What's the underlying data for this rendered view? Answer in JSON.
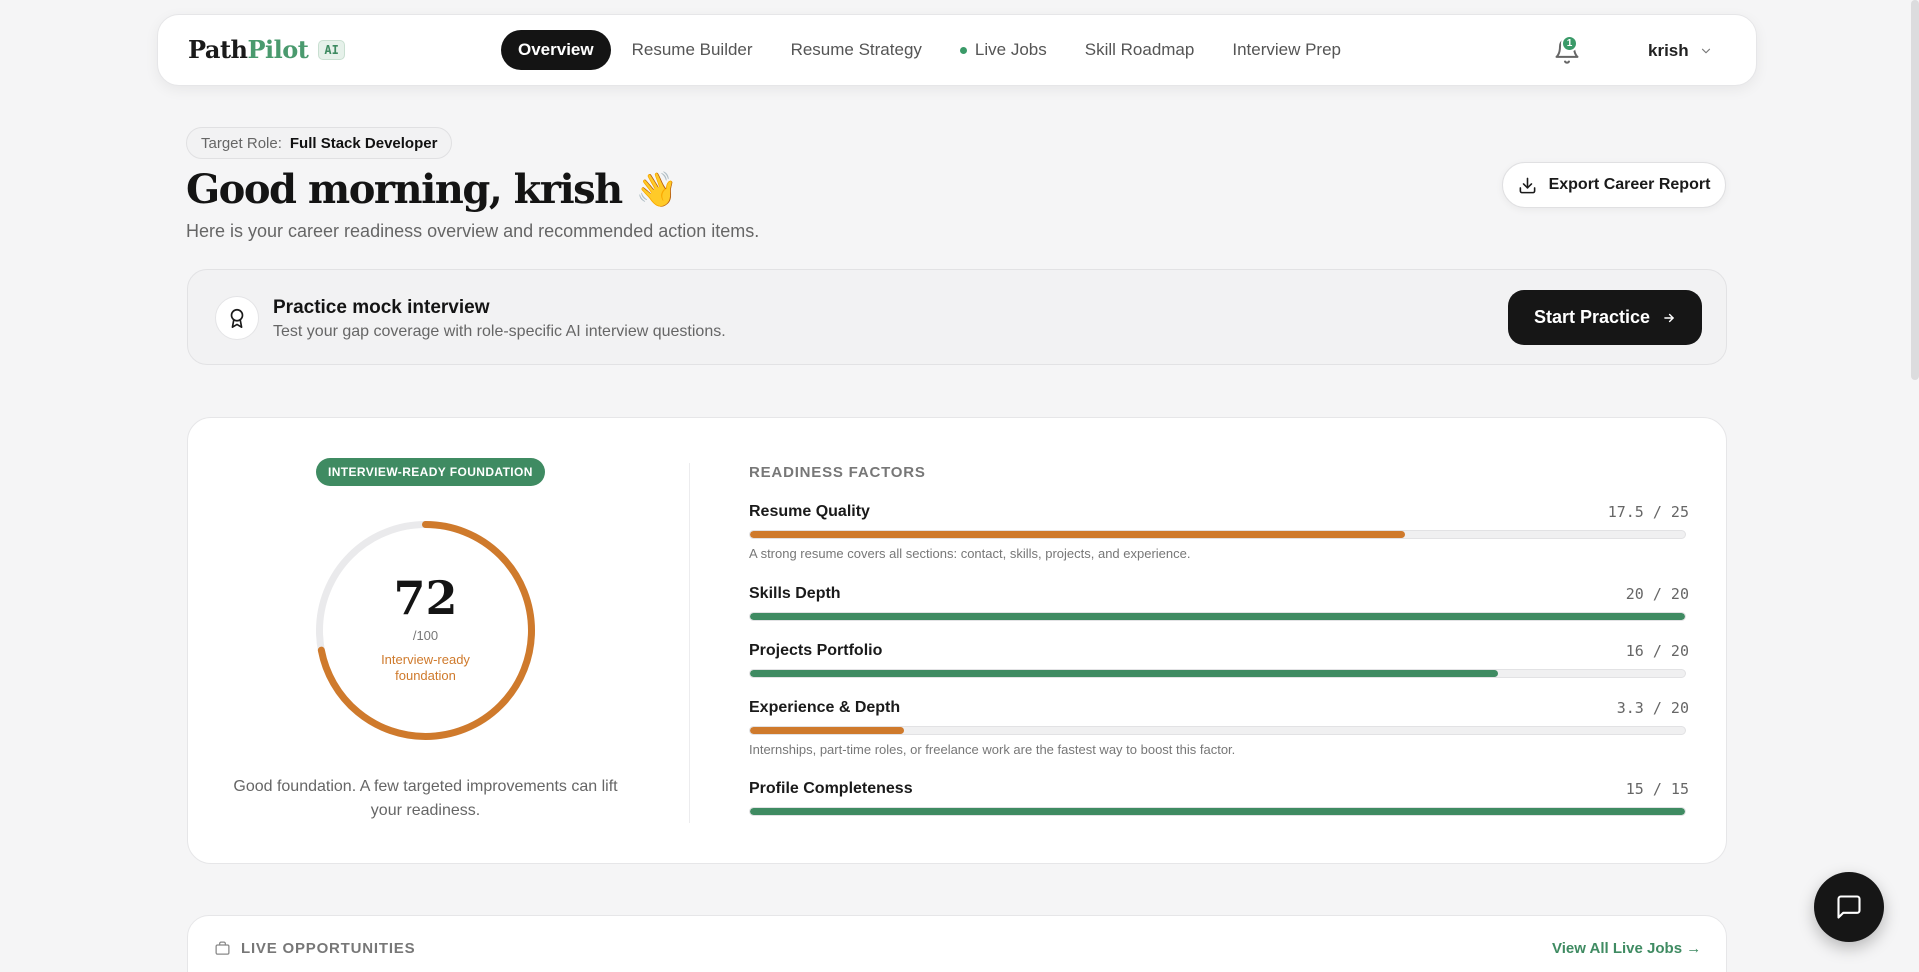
{
  "brand": {
    "path": "Path",
    "pilot": "Pilot",
    "badge": "AI"
  },
  "nav": {
    "tabs": [
      {
        "label": "Overview",
        "active": true
      },
      {
        "label": "Resume Builder"
      },
      {
        "label": "Resume Strategy"
      },
      {
        "label": "Live Jobs",
        "live": true
      },
      {
        "label": "Skill Roadmap"
      },
      {
        "label": "Interview Prep"
      }
    ],
    "notifications_count": "1",
    "user_name": "krish"
  },
  "header": {
    "target_role_label": "Target Role:",
    "target_role_value": "Full Stack Developer",
    "greeting": "Good morning, krish",
    "wave_emoji": "👋",
    "subtitle": "Here is your career readiness overview and recommended action items.",
    "export_label": "Export Career Report"
  },
  "practice": {
    "title": "Practice mock interview",
    "description": "Test your gap coverage with role-specific AI interview questions.",
    "button_label": "Start Practice"
  },
  "readiness": {
    "badge": "INTERVIEW-READY FOUNDATION",
    "score": "72",
    "score_of": "/100",
    "score_label": "Interview-ready foundation",
    "score_value": 72,
    "note": "Good foundation. A few targeted improvements can lift your readiness.",
    "factors_title": "READINESS FACTORS",
    "factors": [
      {
        "name": "Resume Quality",
        "score": "17.5 / 25",
        "fraction": 0.7,
        "color": "orange",
        "note": "A strong resume covers all sections: contact, skills, projects, and experience."
      },
      {
        "name": "Skills Depth",
        "score": "20 / 20",
        "fraction": 1.0,
        "color": "green",
        "note": ""
      },
      {
        "name": "Projects Portfolio",
        "score": "16 / 20",
        "fraction": 0.8,
        "color": "green",
        "note": ""
      },
      {
        "name": "Experience & Depth",
        "score": "3.3 / 20",
        "fraction": 0.165,
        "color": "orange",
        "note": "Internships, part-time roles, or freelance work are the fastest way to boost this factor."
      },
      {
        "name": "Profile Completeness",
        "score": "15 / 15",
        "fraction": 1.0,
        "color": "green",
        "note": ""
      }
    ]
  },
  "opportunities": {
    "title": "LIVE OPPORTUNITIES",
    "link_label": "View All Live Jobs →"
  },
  "colors": {
    "accent_green": "#3f8b62",
    "accent_orange": "#cf7a2c",
    "dark": "#161616"
  }
}
